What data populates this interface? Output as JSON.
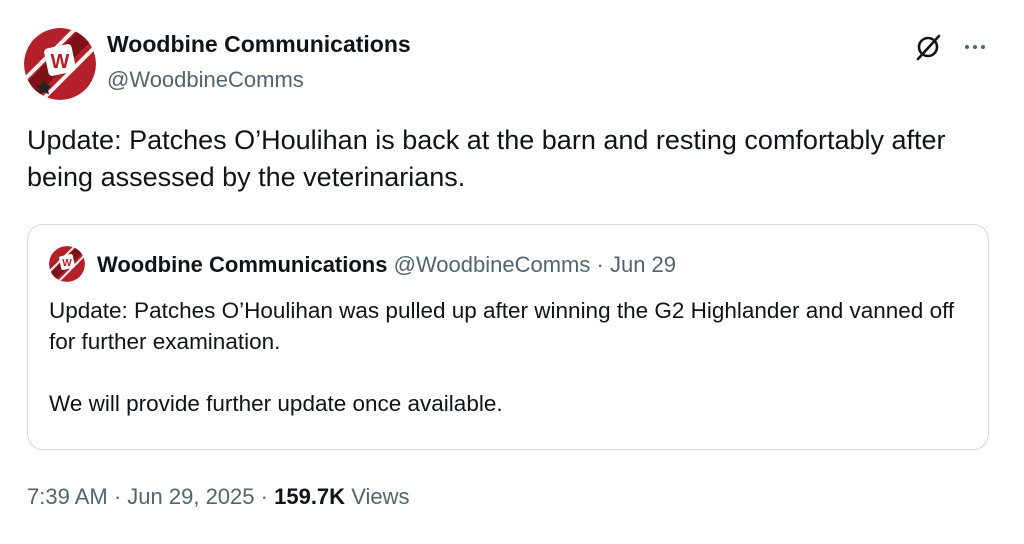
{
  "tweet": {
    "author": {
      "name": "Woodbine Communications",
      "handle": "@WoodbineComms",
      "avatar_logo": "W"
    },
    "icons": {
      "grok": "grok-icon",
      "more": "more-icon"
    },
    "text": "Update: Patches O’Houlihan is back at the barn and resting comfortably after being assessed by the veterinarians.",
    "quoted": {
      "name": "Woodbine Communications",
      "handle": "@WoodbineComms",
      "separator": "·",
      "date": "Jun 29",
      "paragraph_1": "Update: Patches O’Houlihan was pulled up after winning the G2 Highlander and vanned off for further examination.",
      "paragraph_2": "We will provide further update once available."
    },
    "meta": {
      "time": "7:39 AM",
      "separator": "·",
      "date": "Jun 29, 2025",
      "views_count": "159.7K",
      "views_label": "Views"
    }
  },
  "colors": {
    "text_primary": "#0f1419",
    "text_secondary": "#536471",
    "border": "#cfd9de",
    "logo_red": "#b3202a"
  }
}
